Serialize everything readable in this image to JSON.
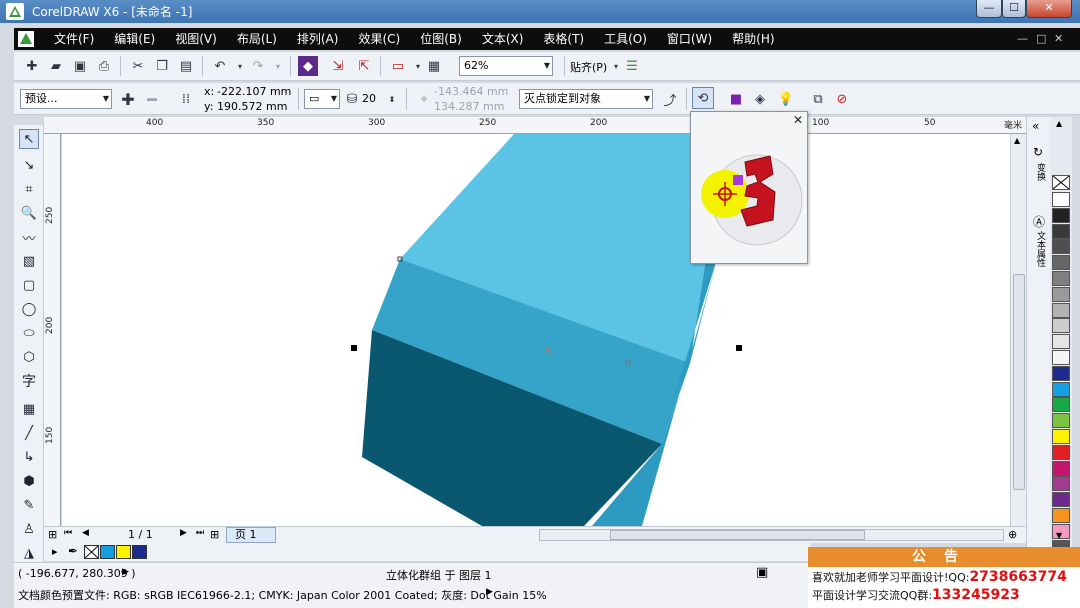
{
  "window": {
    "title": "CorelDRAW X6 - [未命名 -1]",
    "minimize": "—",
    "maximize": "☐",
    "close": "✕"
  },
  "menu": {
    "items": [
      "文件(F)",
      "编辑(E)",
      "视图(V)",
      "布局(L)",
      "排列(A)",
      "效果(C)",
      "位图(B)",
      "文本(X)",
      "表格(T)",
      "工具(O)",
      "窗口(W)",
      "帮助(H)"
    ],
    "doc_controls": [
      "—",
      "□",
      "✕"
    ]
  },
  "standard_toolbar": {
    "zoom": "62%",
    "snap": "贴齐(P)"
  },
  "property_bar": {
    "preset": "预设...",
    "x_label": "x:",
    "x_value": "-222.107 mm",
    "y_label": "y:",
    "y_value": "190.572 mm",
    "depth": "20",
    "vp_x": "-143.464 mm",
    "vp_y": "134.287 mm",
    "vanishing_lock": "灭点锁定到对象"
  },
  "ruler": {
    "h_labels": [
      "400",
      "350",
      "300",
      "250",
      "200",
      "150",
      "100",
      "50"
    ],
    "unit": "毫米",
    "v_labels": [
      "250",
      "200",
      "150"
    ]
  },
  "page_nav": {
    "counter": "1 / 1",
    "tab": "页 1"
  },
  "status": {
    "coords": "( -196.677, 280.309 )",
    "selection": "立体化群组 于 图层 1",
    "color_profile": "文档颜色预置文件: RGB: sRGB IEC61966-2.1; CMYK: Japan Color 2001 Coated; 灰度: Dot Gain 15%"
  },
  "dock": {
    "tabs": [
      "变换",
      "文本属性"
    ]
  },
  "announcement": {
    "title": "公告",
    "line1_text": "喜欢就加老师学习平面设计!QQ:",
    "line1_num": "2738663774",
    "line2_text": "平面设计学习交流QQ群:",
    "line2_num": "133245923"
  },
  "colors": {
    "cube_top": "#5bc3e6",
    "cube_mid": "#36a4c9",
    "cube_right": "#2d9ac2",
    "cube_front": "#0a5870",
    "accent_orange": "#e88d2d",
    "accent_red": "#e01010"
  },
  "palette_colors": [
    "#ffffff",
    "#222222",
    "#3a3a3a",
    "#4f4f4f",
    "#666666",
    "#7f7f7f",
    "#999999",
    "#b2b2b2",
    "#cccccc",
    "#e5e5e5",
    "#f5f5f5",
    "#1d2b8f",
    "#14a0e0",
    "#18a848",
    "#7dc242",
    "#fff200",
    "#e31e24",
    "#c1166b",
    "#a23a8e",
    "#6d2a8a",
    "#f7941d",
    "#f49ac1",
    "#555555"
  ],
  "color_strip": [
    "#14a0e0",
    "#fff200",
    "#1d2b8f"
  ]
}
